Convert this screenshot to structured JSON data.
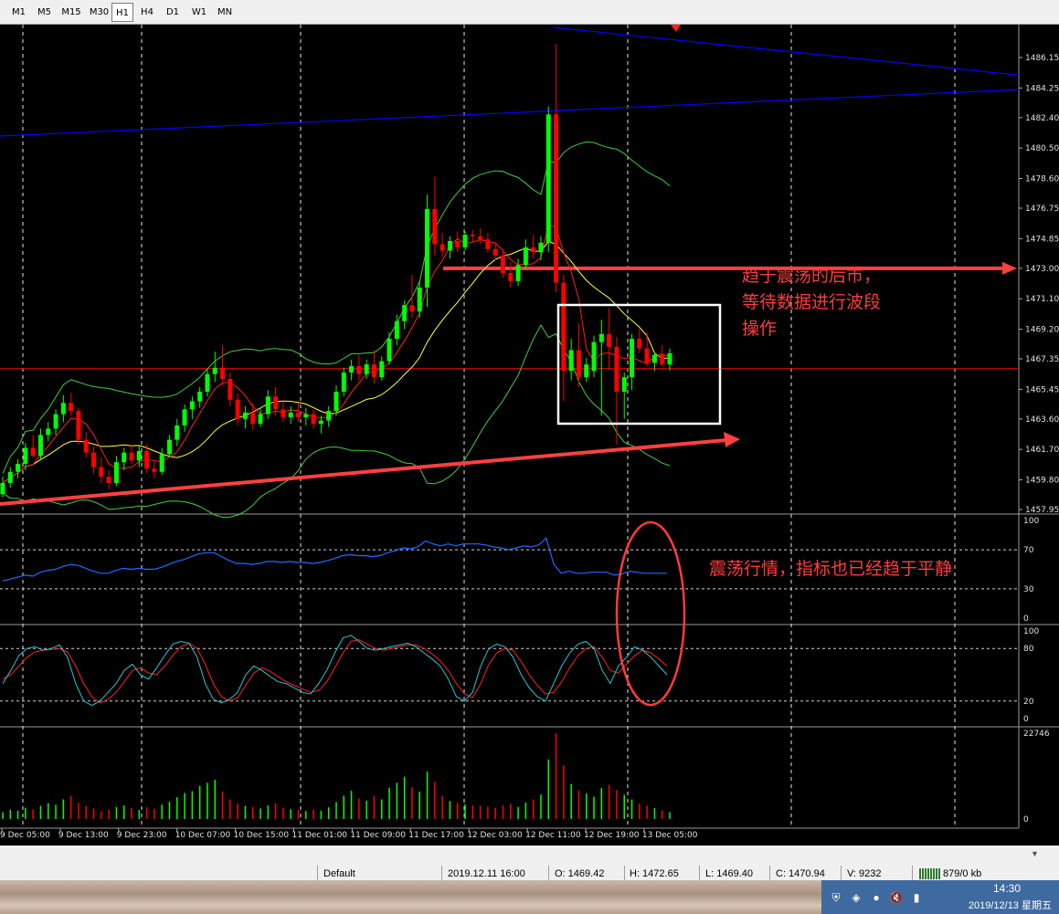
{
  "timeframes": [
    {
      "label": "M1",
      "active": false
    },
    {
      "label": "M5",
      "active": false
    },
    {
      "label": "M15",
      "active": false
    },
    {
      "label": "M30",
      "active": false
    },
    {
      "label": "H1",
      "active": true
    },
    {
      "label": "H4",
      "active": false
    },
    {
      "label": "D1",
      "active": false
    },
    {
      "label": "W1",
      "active": false
    },
    {
      "label": "MN",
      "active": false
    }
  ],
  "price_axis": {
    "ticks": [
      "1486.15",
      "1484.25",
      "1482.40",
      "1480.50",
      "1478.60",
      "1476.75",
      "1474.85",
      "1473.00",
      "1471.10",
      "1469.20",
      "1467.35",
      "1465.45",
      "1463.60",
      "1461.70",
      "1459.80",
      "1457.95"
    ],
    "current_price": "1466.74"
  },
  "rsi_axis": {
    "ticks": [
      "100",
      "70",
      "30",
      "0"
    ]
  },
  "stoch_axis": {
    "ticks": [
      "100",
      "80",
      "20",
      "0"
    ]
  },
  "volume_axis": {
    "ticks": [
      "22746",
      "0"
    ]
  },
  "time_axis": {
    "labels": [
      "9 Dec 05:00",
      "9 Dec 13:00",
      "9 Dec 23:00",
      "10 Dec 07:00",
      "10 Dec 15:00",
      "11 Dec 01:00",
      "11 Dec 09:00",
      "11 Dec 17:00",
      "12 Dec 03:00",
      "12 Dec 11:00",
      "12 Dec 19:00",
      "13 Dec 05:00"
    ]
  },
  "annotations": {
    "main_note_line1": "趋于震荡的后市，",
    "main_note_line2": "等待数据进行波段",
    "main_note_line3": "操作",
    "indicator_note": "震荡行情，指标也已经趋于平静"
  },
  "status_bar": {
    "profile": "Default",
    "datetime": "2019.12.11 16:00",
    "open": "O: 1469.42",
    "high": "H: 1472.65",
    "low": "L: 1469.40",
    "close": "C: 1470.94",
    "volume": "V: 9232",
    "traffic": "879/0 kb"
  },
  "taskbar": {
    "time": "14:30",
    "date": "2019/12/13 星期五",
    "tray_icons": [
      "shield-icon",
      "network-box-icon",
      "qq-penguin-icon",
      "speaker-muted-icon",
      "signal-icon"
    ]
  },
  "colors": {
    "bull": "#00ff00",
    "bear": "#ff0000",
    "trendline": "#0000ff",
    "annotation": "#ff3b3b",
    "rsi": "#1e6bff",
    "stoch_main": "#2ec4d4",
    "stoch_signal": "#ff2020"
  },
  "chart_data": {
    "type": "candlestick",
    "symbol_timeframe": "H1",
    "ylim": [
      1457.95,
      1487.0
    ],
    "candles": [
      [
        1458.9,
        1460.0,
        1458.7,
        1459.6
      ],
      [
        1459.6,
        1460.6,
        1459.3,
        1460.3
      ],
      [
        1460.3,
        1461.1,
        1459.9,
        1460.8
      ],
      [
        1460.8,
        1462.1,
        1460.4,
        1461.8
      ],
      [
        1461.8,
        1462.6,
        1461.2,
        1461.3
      ],
      [
        1461.3,
        1463.0,
        1461.0,
        1462.6
      ],
      [
        1462.6,
        1463.4,
        1462.2,
        1463.0
      ],
      [
        1463.0,
        1464.2,
        1462.6,
        1463.9
      ],
      [
        1463.9,
        1465.1,
        1463.4,
        1464.6
      ],
      [
        1464.6,
        1465.2,
        1463.8,
        1464.1
      ],
      [
        1464.1,
        1464.3,
        1462.0,
        1462.3
      ],
      [
        1462.3,
        1462.8,
        1461.2,
        1461.5
      ],
      [
        1461.5,
        1461.9,
        1460.2,
        1460.6
      ],
      [
        1460.6,
        1461.2,
        1459.6,
        1460.0
      ],
      [
        1460.0,
        1460.4,
        1459.2,
        1459.6
      ],
      [
        1459.6,
        1461.3,
        1459.4,
        1460.9
      ],
      [
        1460.9,
        1461.8,
        1460.4,
        1461.5
      ],
      [
        1461.5,
        1462.0,
        1460.8,
        1461.0
      ],
      [
        1461.0,
        1461.9,
        1460.6,
        1461.6
      ],
      [
        1461.6,
        1462.0,
        1460.2,
        1460.5
      ],
      [
        1460.5,
        1461.0,
        1459.9,
        1460.3
      ],
      [
        1460.3,
        1461.8,
        1460.1,
        1461.4
      ],
      [
        1461.4,
        1462.6,
        1461.2,
        1462.3
      ],
      [
        1462.3,
        1463.6,
        1461.9,
        1463.2
      ],
      [
        1463.2,
        1464.5,
        1462.8,
        1464.2
      ],
      [
        1464.2,
        1465.0,
        1463.6,
        1464.7
      ],
      [
        1464.7,
        1465.6,
        1464.3,
        1465.3
      ],
      [
        1465.3,
        1466.7,
        1465.0,
        1466.4
      ],
      [
        1466.4,
        1467.8,
        1465.9,
        1466.8
      ],
      [
        1466.8,
        1468.2,
        1465.7,
        1466.1
      ],
      [
        1466.1,
        1466.5,
        1464.4,
        1464.8
      ],
      [
        1464.8,
        1465.2,
        1463.2,
        1463.6
      ],
      [
        1463.6,
        1464.4,
        1463.0,
        1464.0
      ],
      [
        1464.0,
        1464.6,
        1462.9,
        1463.3
      ],
      [
        1463.3,
        1464.3,
        1463.1,
        1463.9
      ],
      [
        1463.9,
        1465.4,
        1463.6,
        1465.0
      ],
      [
        1465.0,
        1465.6,
        1463.8,
        1464.2
      ],
      [
        1464.2,
        1464.7,
        1463.4,
        1463.7
      ],
      [
        1463.7,
        1464.4,
        1463.3,
        1464.0
      ],
      [
        1464.0,
        1464.6,
        1463.4,
        1463.7
      ],
      [
        1463.7,
        1464.3,
        1463.2,
        1463.9
      ],
      [
        1463.9,
        1464.2,
        1463.0,
        1463.3
      ],
      [
        1463.3,
        1463.8,
        1462.7,
        1463.5
      ],
      [
        1463.5,
        1464.4,
        1463.1,
        1464.1
      ],
      [
        1464.1,
        1465.7,
        1463.8,
        1465.3
      ],
      [
        1465.3,
        1466.8,
        1465.0,
        1466.5
      ],
      [
        1466.5,
        1467.3,
        1466.0,
        1466.9
      ],
      [
        1466.9,
        1467.6,
        1466.0,
        1466.4
      ],
      [
        1466.4,
        1467.3,
        1466.1,
        1467.0
      ],
      [
        1467.0,
        1467.9,
        1465.8,
        1466.2
      ],
      [
        1466.2,
        1467.5,
        1466.0,
        1467.2
      ],
      [
        1467.2,
        1469.0,
        1467.0,
        1468.6
      ],
      [
        1468.6,
        1470.1,
        1468.2,
        1469.7
      ],
      [
        1469.7,
        1471.0,
        1469.2,
        1470.7
      ],
      [
        1470.7,
        1472.6,
        1469.9,
        1470.3
      ],
      [
        1470.3,
        1472.2,
        1469.9,
        1471.8
      ],
      [
        1471.8,
        1477.6,
        1470.6,
        1476.7
      ],
      [
        1476.7,
        1478.7,
        1473.8,
        1474.5
      ],
      [
        1474.5,
        1475.2,
        1473.7,
        1474.1
      ],
      [
        1474.1,
        1475.0,
        1473.6,
        1474.7
      ],
      [
        1474.7,
        1475.3,
        1474.0,
        1474.3
      ],
      [
        1474.3,
        1475.3,
        1474.1,
        1475.1
      ],
      [
        1475.1,
        1475.4,
        1474.6,
        1475.0
      ],
      [
        1475.0,
        1475.5,
        1474.5,
        1474.8
      ],
      [
        1474.8,
        1475.2,
        1474.0,
        1474.2
      ],
      [
        1474.2,
        1474.6,
        1473.5,
        1473.8
      ],
      [
        1473.8,
        1474.2,
        1472.4,
        1472.7
      ],
      [
        1472.7,
        1473.4,
        1471.8,
        1472.2
      ],
      [
        1472.2,
        1473.6,
        1471.9,
        1473.2
      ],
      [
        1473.2,
        1474.8,
        1472.9,
        1474.3
      ],
      [
        1474.3,
        1475.1,
        1473.6,
        1474.0
      ],
      [
        1474.0,
        1475.0,
        1473.5,
        1474.6
      ],
      [
        1474.6,
        1483.1,
        1474.0,
        1482.6
      ],
      [
        1482.6,
        1487.0,
        1471.5,
        1472.1
      ],
      [
        1472.1,
        1472.6,
        1464.7,
        1466.6
      ],
      [
        1466.6,
        1468.6,
        1466.0,
        1467.9
      ],
      [
        1467.9,
        1469.6,
        1465.6,
        1466.2
      ],
      [
        1466.2,
        1467.4,
        1465.9,
        1467.0
      ],
      [
        1466.6,
        1468.8,
        1466.2,
        1468.4
      ],
      [
        1468.4,
        1469.8,
        1463.8,
        1468.9
      ],
      [
        1468.9,
        1470.5,
        1466.7,
        1468.1
      ],
      [
        1468.1,
        1468.7,
        1462.0,
        1465.3
      ],
      [
        1465.3,
        1466.5,
        1463.6,
        1466.2
      ],
      [
        1466.2,
        1468.9,
        1465.4,
        1468.6
      ],
      [
        1468.6,
        1469.2,
        1467.7,
        1468.0
      ],
      [
        1468.0,
        1469.0,
        1466.9,
        1467.1
      ],
      [
        1467.1,
        1467.8,
        1466.6,
        1467.6
      ],
      [
        1467.6,
        1468.2,
        1466.9,
        1467.0
      ],
      [
        1467.0,
        1468.0,
        1466.6,
        1467.7
      ]
    ],
    "trendlines": [
      {
        "name": "upper-channel",
        "y_start": 1486.65,
        "y_end": 1485.05
      },
      {
        "name": "lower-channel",
        "y_start": 1481.25,
        "y_end": 1484.15
      },
      {
        "name": "horizontal-resistance",
        "y": 1473.0
      },
      {
        "name": "current-price-line",
        "y": 1466.74
      }
    ],
    "rsi": [
      38,
      40,
      42,
      44,
      43,
      47,
      49,
      50,
      53,
      55,
      54,
      51,
      48,
      46,
      46,
      49,
      51,
      50,
      51,
      50,
      50,
      52,
      55,
      58,
      60,
      63,
      66,
      67,
      67,
      63,
      59,
      56,
      56,
      55,
      56,
      58,
      58,
      57,
      58,
      57,
      57,
      56,
      57,
      59,
      61,
      64,
      65,
      64,
      64,
      63,
      64,
      67,
      69,
      72,
      71,
      73,
      79,
      76,
      74,
      76,
      74,
      76,
      76,
      76,
      75,
      73,
      72,
      70,
      72,
      74,
      73,
      75,
      82,
      55,
      46,
      48,
      46,
      46,
      47,
      47,
      47,
      44,
      45,
      48,
      47,
      46,
      46,
      46,
      46
    ],
    "stochastic_main": [
      40,
      55,
      72,
      80,
      82,
      78,
      80,
      84,
      70,
      40,
      20,
      15,
      20,
      30,
      40,
      55,
      62,
      50,
      45,
      58,
      72,
      85,
      88,
      86,
      70,
      40,
      22,
      18,
      22,
      30,
      50,
      60,
      55,
      48,
      42,
      40,
      35,
      30,
      28,
      40,
      55,
      75,
      92,
      95,
      88,
      80,
      78,
      80,
      82,
      84,
      86,
      82,
      75,
      68,
      60,
      45,
      25,
      20,
      30,
      60,
      80,
      85,
      82,
      70,
      50,
      35,
      25,
      20,
      40,
      60,
      75,
      85,
      88,
      80,
      55,
      40,
      60,
      70,
      82,
      78,
      70,
      60,
      50
    ],
    "stochastic_signal": [
      45,
      50,
      60,
      70,
      76,
      78,
      79,
      80,
      76,
      60,
      40,
      25,
      18,
      22,
      30,
      42,
      55,
      58,
      52,
      50,
      60,
      72,
      82,
      86,
      80,
      62,
      40,
      25,
      20,
      24,
      38,
      52,
      58,
      54,
      48,
      42,
      38,
      34,
      30,
      32,
      42,
      58,
      75,
      88,
      90,
      85,
      80,
      78,
      80,
      82,
      84,
      84,
      80,
      74,
      66,
      55,
      40,
      28,
      24,
      40,
      62,
      75,
      80,
      78,
      65,
      50,
      38,
      28,
      30,
      42,
      58,
      72,
      80,
      82,
      70,
      55,
      52,
      62,
      72,
      78,
      75,
      68,
      60
    ],
    "volume": [
      1800,
      2500,
      2200,
      3000,
      2600,
      3500,
      4200,
      3800,
      5200,
      6100,
      4300,
      3500,
      2800,
      2100,
      2500,
      3200,
      3600,
      2900,
      2400,
      3100,
      2700,
      3800,
      4600,
      5800,
      6900,
      7400,
      8800,
      9600,
      10400,
      7300,
      5200,
      4100,
      3500,
      3200,
      2800,
      3600,
      4200,
      2900,
      2600,
      2400,
      2100,
      2500,
      2200,
      3100,
      4500,
      6200,
      7500,
      5400,
      4900,
      6100,
      5200,
      8300,
      9600,
      11200,
      8400,
      7300,
      12600,
      9800,
      6100,
      4800,
      4300,
      3900,
      3700,
      3500,
      3300,
      3000,
      3600,
      4100,
      3200,
      4400,
      5200,
      6500,
      15800,
      22746,
      14200,
      9300,
      7600,
      6800,
      5900,
      8200,
      9100,
      7700,
      6400,
      5200,
      4100,
      3600,
      2900,
      2300,
      1800
    ]
  }
}
